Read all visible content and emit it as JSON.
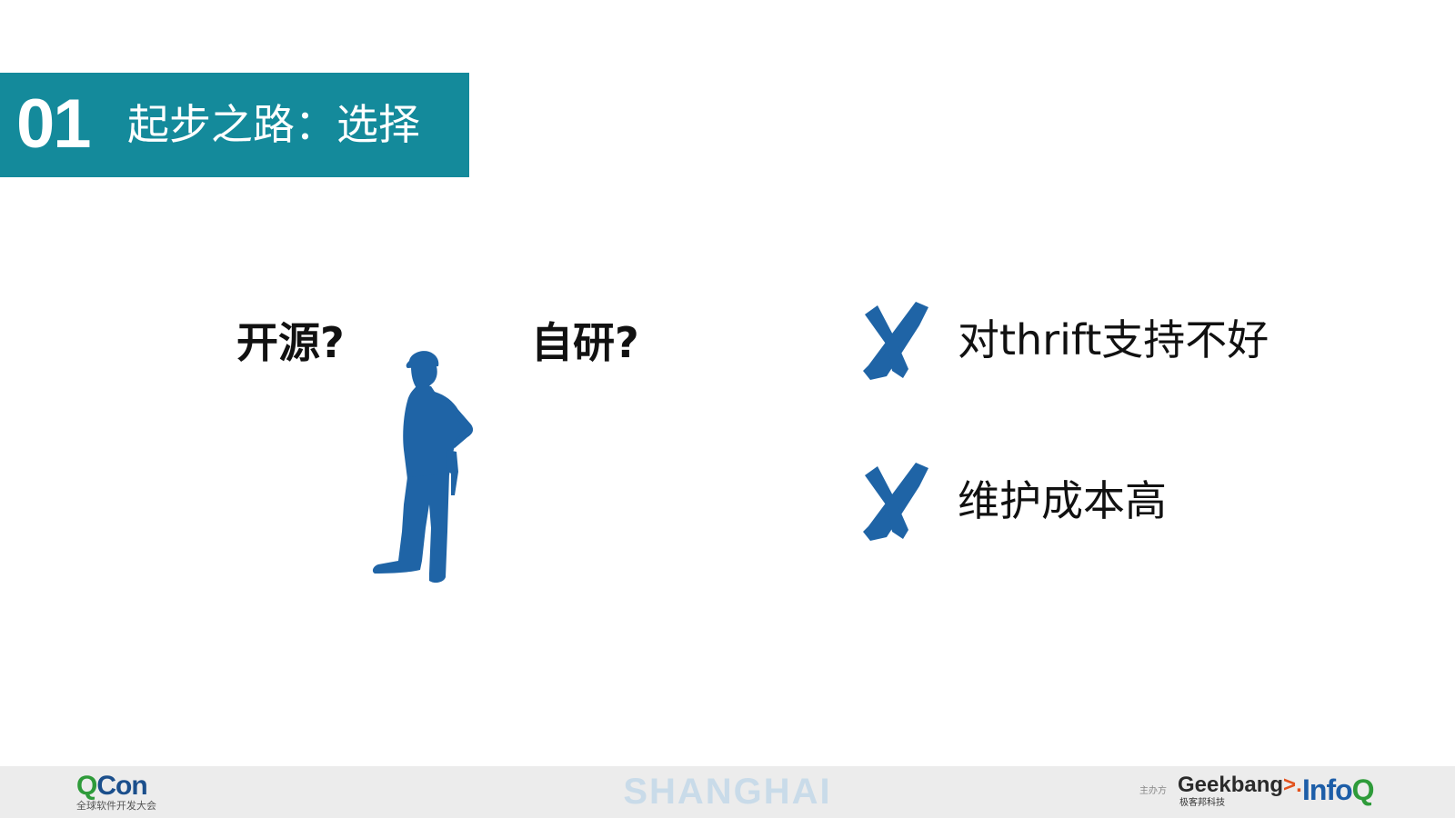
{
  "header": {
    "number": "01",
    "title": "起步之路：选择"
  },
  "questions": {
    "open_source": "开源?",
    "self_developed": "自研?"
  },
  "reasons": [
    {
      "icon": "x-mark-icon",
      "text": "对thrift支持不好"
    },
    {
      "icon": "x-mark-icon",
      "text": "维护成本高"
    }
  ],
  "footer": {
    "qcon_q": "Q",
    "qcon_con": "Con",
    "qcon_subtitle": "全球软件开发大会",
    "city": "SHANGHAI",
    "host_label": "主办方",
    "geekbang_main": "Geekbang",
    "geekbang_arrow": ">.",
    "geekbang_subtitle": "极客邦科技",
    "infoq_main": "Info",
    "infoq_q": "Q"
  },
  "colors": {
    "banner": "#148a9b",
    "icon_blue": "#1f64a6",
    "text": "#111111",
    "footer_bg": "#ececec",
    "city_text": "#c9dbe9"
  }
}
